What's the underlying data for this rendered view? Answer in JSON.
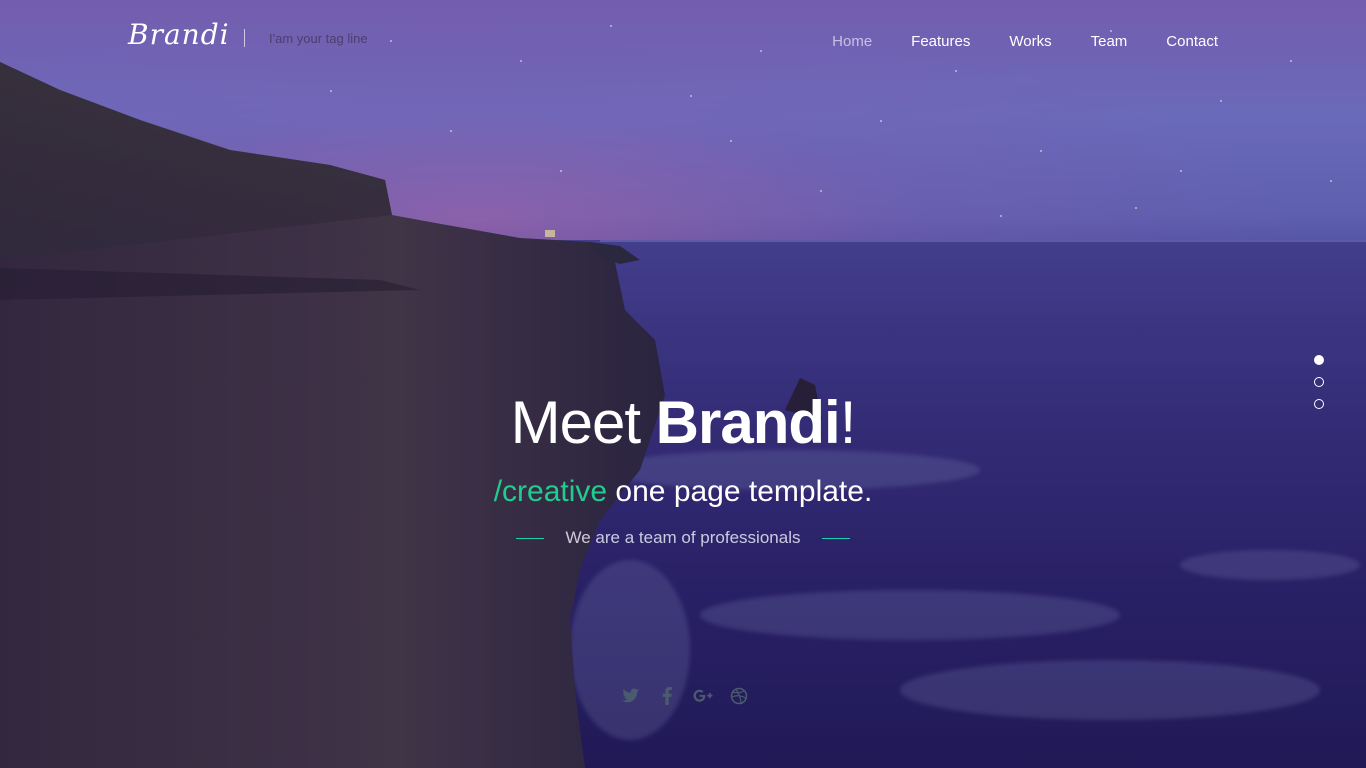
{
  "brand": {
    "logo": "Brandi",
    "tagline": "I'am your tag line"
  },
  "nav": {
    "items": [
      {
        "label": "Home",
        "active": true
      },
      {
        "label": "Features",
        "active": false
      },
      {
        "label": "Works",
        "active": false
      },
      {
        "label": "Team",
        "active": false
      },
      {
        "label": "Contact",
        "active": false
      }
    ]
  },
  "hero": {
    "headline_prefix": "Meet ",
    "headline_bold": "Brandi",
    "headline_suffix": "!",
    "sub_accent": "/creative",
    "sub_rest": " one page template.",
    "tagline": "We are a team of professionals"
  },
  "slider": {
    "slides": 3,
    "active_index": 0
  },
  "social": {
    "icons": [
      "twitter-icon",
      "facebook-icon",
      "google-plus-icon",
      "dribbble-icon"
    ]
  },
  "colors": {
    "accent": "#1fce8f",
    "rule": "#1fd0b0",
    "icon": "#4a5a6a"
  }
}
